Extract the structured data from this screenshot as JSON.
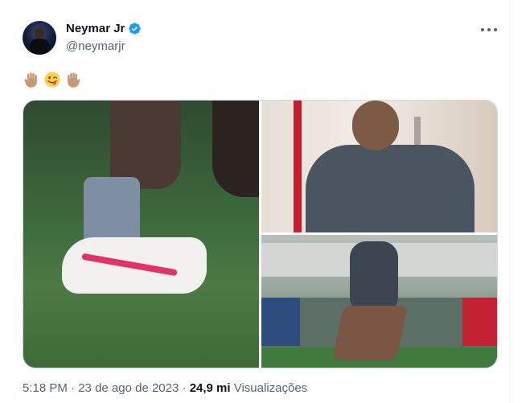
{
  "author": {
    "name": "Neymar Jr",
    "handle": "@neymarjr"
  },
  "tweet_text_emojis": [
    "raised-hand-icon",
    "winking-face-tongue-icon",
    "raised-hand-icon"
  ],
  "media": [
    {
      "label": "Football boot photo"
    },
    {
      "label": "Training photo top"
    },
    {
      "label": "Training photo bottom"
    }
  ],
  "footer": {
    "time": "5:18 PM",
    "separator1": " · ",
    "date": "23 de ago de 2023",
    "separator2": " · ",
    "views_count": "24,9 mi",
    "views_label": " Visualizações"
  },
  "colors": {
    "verified": "#1d9bf0",
    "muted_text": "#536471",
    "text": "#0f1419"
  }
}
